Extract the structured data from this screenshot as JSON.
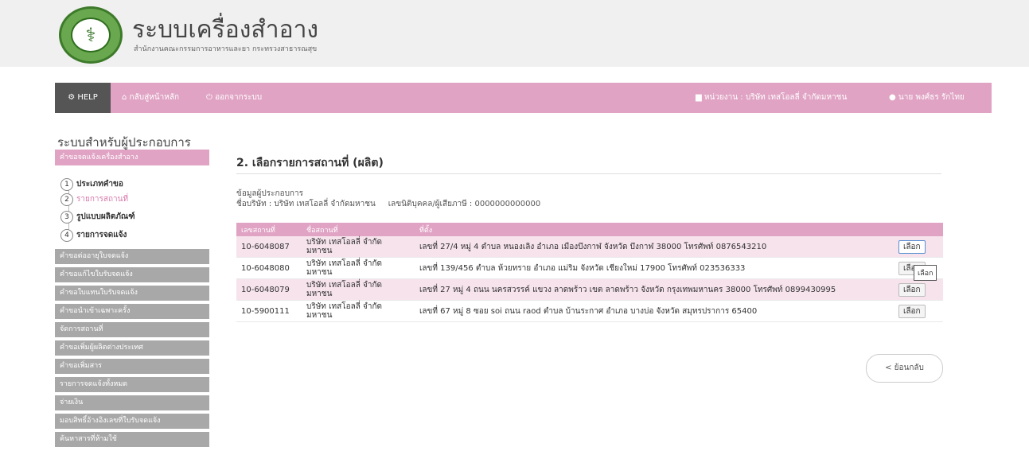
{
  "header": {
    "title": "ระบบเครื่องสำอาง",
    "subtitle": "สำนักงานคณะกรรมการอาหารและยา กระทรวงสาธารณสุข"
  },
  "nav": {
    "help": "HELP",
    "home": "กลับสู่หน้าหลัก",
    "logout": "ออกจากระบบ",
    "org": "หน่วยงาน : บริษัท เทสโอลลี่ จำกัดมหาชน",
    "user": "นาย พงศ์ธร รักไทย"
  },
  "sidebar": {
    "title": "ระบบสำหรับผู้ประกอบการ",
    "active_menu": "คำขอจดแจ้งเครื่องสำอาง",
    "steps": [
      {
        "num": "1",
        "label": "ประเภทคำขอ"
      },
      {
        "num": "2",
        "label": "รายการสถานที่"
      },
      {
        "num": "3",
        "label": "รูปแบบผลิตภัณฑ์"
      },
      {
        "num": "4",
        "label": "รายการจดแจ้ง"
      }
    ],
    "menu": [
      "คำขอต่ออายุใบจดแจ้ง",
      "คำขอแก้ไขใบรับจดแจ้ง",
      "คำขอใบแทนใบรับจดแจ้ง",
      "คำขอนำเข้าเฉพาะครั้ง",
      "จัดการสถานที่",
      "คำขอเพิ่มผู้ผลิตต่างประเทศ",
      "คำขอเพิ่มสาร",
      "รายการจดแจ้งทั้งหมด",
      "จ่ายเงิน",
      "มอบสิทธิ์อ้างอิงเลขที่ใบรับจดแจ้ง",
      "ค้นหาสารที่ห้ามใช้"
    ]
  },
  "main": {
    "title": "2. เลือกรายการสถานที่ (ผลิต)",
    "info_heading": "ข้อมูลผู้ประกอบการ",
    "info_line": "ชื่อบริษัท : บริษัท เทสโอลลี่ จำกัดมหาชน     เลขนิติบุคคล/ผู้เสียภาษี : 0000000000000",
    "columns": [
      "เลขสถานที่",
      "ชื่อสถานที่",
      "ที่ตั้ง",
      ""
    ],
    "rows": [
      {
        "id": "10-6048087",
        "name": "บริษัท เทสโอลลี่ จำกัด มหาชน",
        "addr": "เลขที่ 27/4 หมู่ 4 ตำบล หนองเลิง อำเภอ เมืองบึงกาฬ จังหวัด บึงกาฬ 38000 โทรศัพท์ 0876543210",
        "btn": "เลือก"
      },
      {
        "id": "10-6048080",
        "name": "บริษัท เทสโอลลี่ จำกัด มหาชน",
        "addr": "เลขที่ 139/456 ตำบล ห้วยทราย อำเภอ แม่ริม จังหวัด เชียงใหม่ 17900 โทรศัพท์ 023536333",
        "btn": "เลือก"
      },
      {
        "id": "10-6048079",
        "name": "บริษัท เทสโอลลี่ จำกัด มหาชน",
        "addr": "เลขที่ 27 หมู่ 4 ถนน นครสวรรค์ แขวง ลาดพร้าว เขต ลาดพร้าว จังหวัด กรุงเทพมหานคร 38000 โทรศัพท์ 0899430995",
        "btn": "เลือก"
      },
      {
        "id": "10-5900111",
        "name": "บริษัท เทสโอลลี่ จำกัด มหาชน",
        "addr": "เลขที่ 67 หมู่ 8 ซอย soi ถนน raod ตำบล บ้านระกาศ อำเภอ บางบ่อ จังหวัด สมุทรปราการ 65400",
        "btn": "เลือก"
      }
    ],
    "tooltip": "เลือก",
    "back": "< ย้อนกลับ"
  }
}
